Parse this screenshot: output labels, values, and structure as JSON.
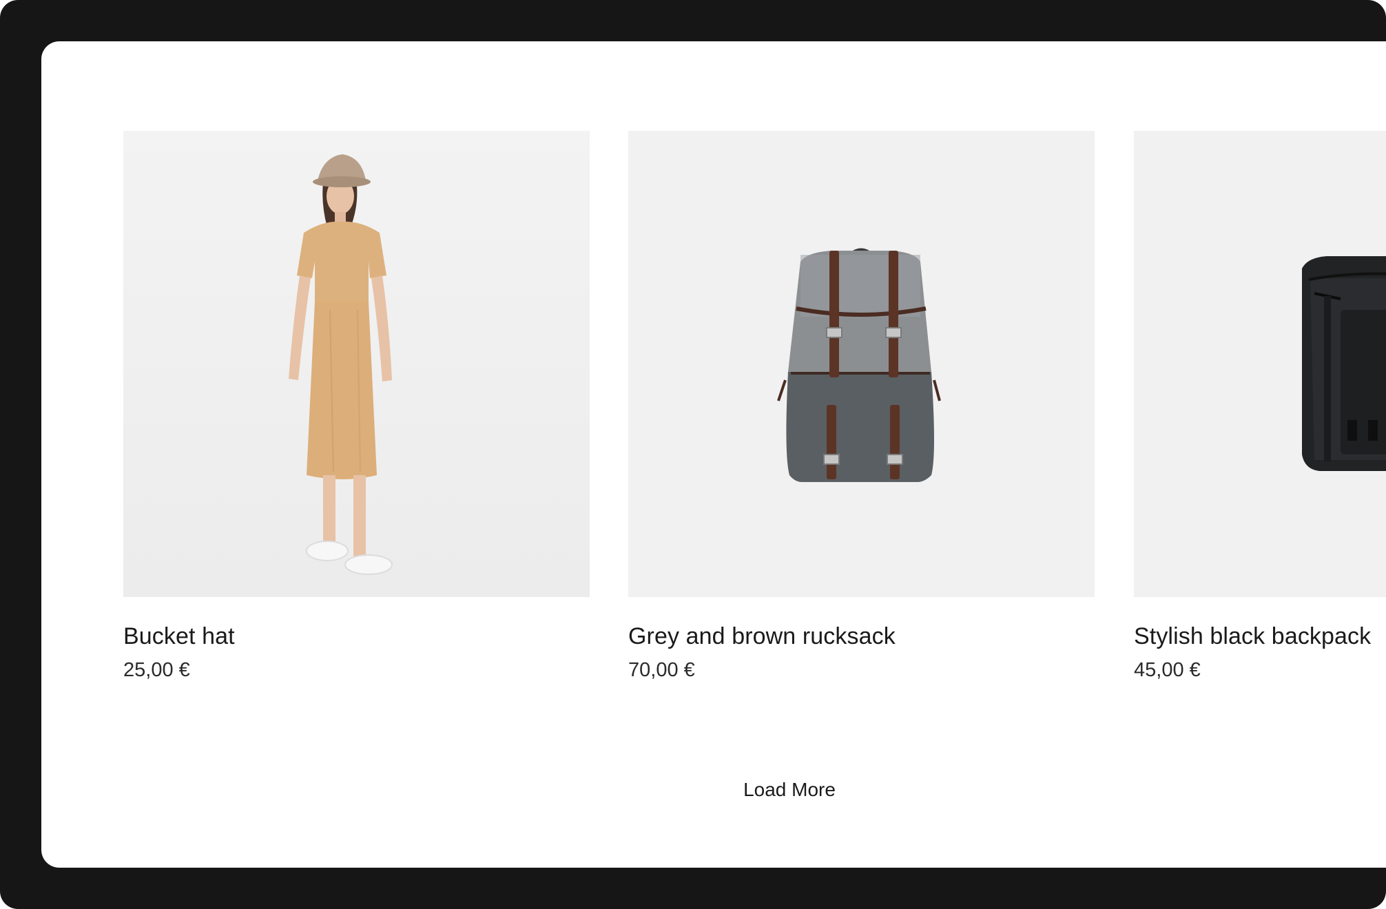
{
  "products": [
    {
      "name": "Bucket hat",
      "price": "25,00 €",
      "image_icon": "woman-in-beige-dress-with-bucket-hat"
    },
    {
      "name": "Grey and brown rucksack",
      "price": "70,00 €",
      "image_icon": "grey-brown-rucksack"
    },
    {
      "name": "Stylish black backpack",
      "price": "45,00 €",
      "image_icon": "black-backpack"
    }
  ],
  "load_more_label": "Load More",
  "colors": {
    "frame": "#161616",
    "card_background": "#f1f1f1",
    "text": "#1a1a1a"
  }
}
